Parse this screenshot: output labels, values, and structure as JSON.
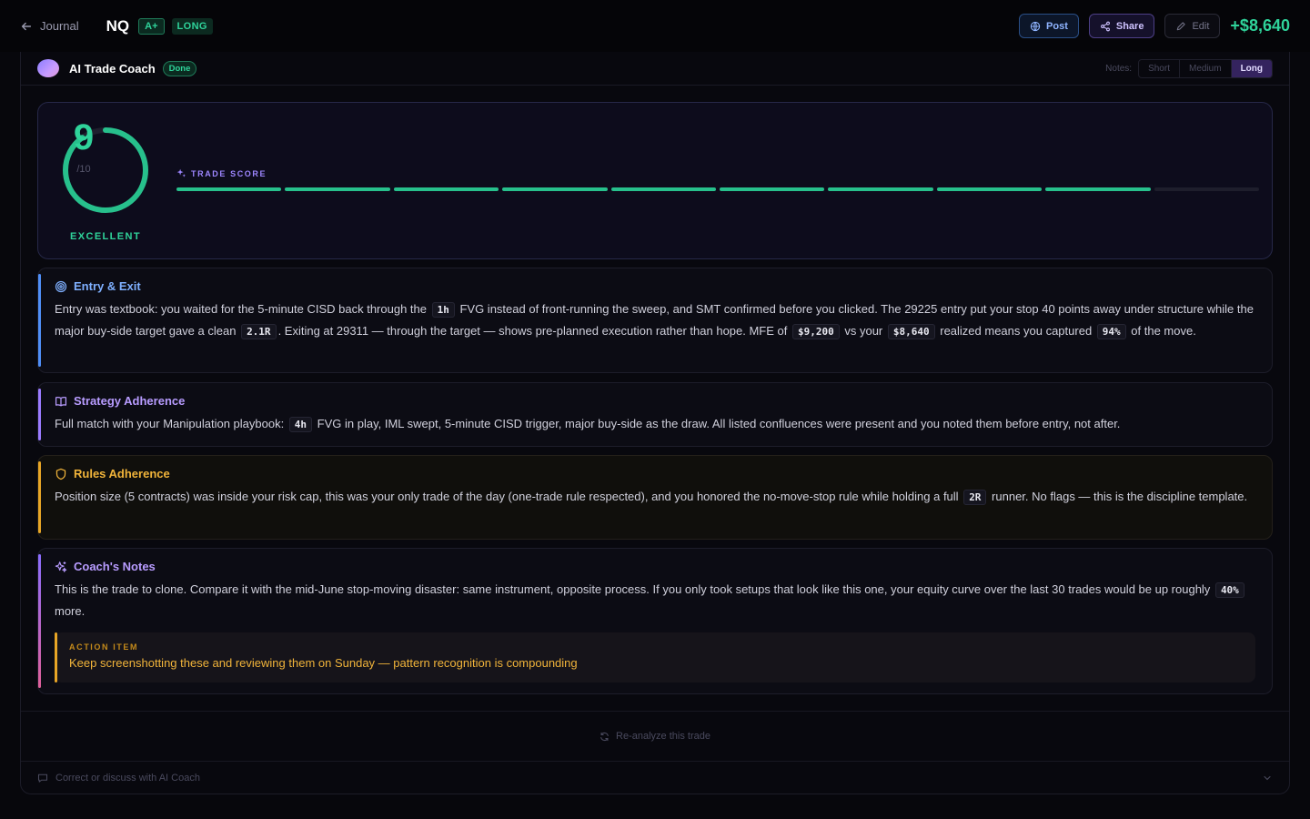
{
  "header": {
    "back_label": "Journal",
    "symbol": "NQ",
    "grade": "A+",
    "direction": "LONG",
    "post_label": "Post",
    "share_label": "Share",
    "edit_label": "Edit",
    "pnl": "+$8,640"
  },
  "coach": {
    "title": "AI Trade Coach",
    "status": "Done",
    "notes_label": "Notes:",
    "notes_options": [
      "Short",
      "Medium",
      "Long"
    ],
    "notes_selected": "Long"
  },
  "score": {
    "value": 9,
    "max": "/10",
    "rating": "EXCELLENT",
    "title": "TRADE SCORE",
    "segments_total": 10,
    "segments_filled": 9
  },
  "sections": {
    "entry": {
      "title": "Entry & Exit",
      "t1": "Entry was textbook: you waited for the 5-minute CISD back through the ",
      "c1": "1h",
      "t2": " FVG instead of front-running the sweep, and SMT confirmed before you clicked. The 29225 entry put your stop 40 points away under structure while the major buy-side target gave a clean ",
      "c2": "2.1R",
      "t3": ". Exiting at 29311 — through the target — shows pre-planned execution rather than hope. MFE of ",
      "c3": "$9,200",
      "t4": " vs your ",
      "c4": "$8,640",
      "t5": " realized means you captured ",
      "c5": "94%",
      "t6": " of the move."
    },
    "strategy": {
      "title": "Strategy Adherence",
      "t1": "Full match with your Manipulation playbook: ",
      "c1": "4h",
      "t2": " FVG in play, IML swept, 5-minute CISD trigger, major buy-side as the draw. All listed confluences were present and you noted them before entry, not after."
    },
    "rules": {
      "title": "Rules Adherence",
      "t1": "Position size (5 contracts) was inside your risk cap, this was your only trade of the day (one-trade rule respected), and you honored the no-move-stop rule while holding a full ",
      "c1": "2R",
      "t2": " runner. No flags — this is the discipline template."
    },
    "notes": {
      "title": "Coach's Notes",
      "t1": "This is the trade to clone. Compare it with the mid-June stop-moving disaster: same instrument, opposite process. If you only took setups that look like this one, your equity curve over the last 30 trades would be up roughly ",
      "c1": "40%",
      "t2": " more.",
      "action_label": "ACTION ITEM",
      "action_text": "Keep screenshotting these and reviewing them on Sunday — pattern recognition is compounding"
    }
  },
  "footer": {
    "reanalyze_label": "Re-analyze this trade",
    "discuss_placeholder": "Correct or discuss with AI Coach"
  },
  "colors": {
    "accent_green": "#2fd39a",
    "accent_purple": "#9b7bff",
    "accent_blue": "#4f8ef7",
    "accent_amber": "#e7a526"
  }
}
